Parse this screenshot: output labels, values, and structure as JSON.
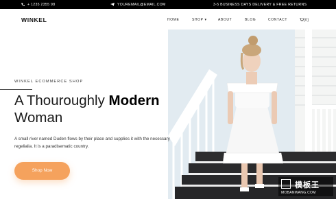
{
  "topbar": {
    "phone": "+ 1235 2355 98",
    "email": "YOUREMAIL@EMAIL.COM",
    "promo": "3-5 BUSINESS DAYS DELIVERY & FREE RETURNS"
  },
  "brand": {
    "logo": "WINKEL"
  },
  "nav": {
    "home": "HOME",
    "shop": "SHOP ▾",
    "about": "ABOUT",
    "blog": "BLOG",
    "contact": "CONTACT",
    "cart": "[0]"
  },
  "hero": {
    "eyebrow": "WINKEL ECOMMERCE SHOP",
    "headline_regular": "A Thouroughly",
    "headline_bold": "Modern",
    "headline_line2": "Woman",
    "description": "A small river named Duden flows by their place and supplies it with the necessary regelialia. It is a paradisematic country.",
    "cta": "Shop Now"
  },
  "watermark": {
    "cn": "模板王",
    "en": "MOBANWANG.COM"
  },
  "colors": {
    "accent": "#f5a25d",
    "topbar": "#000000"
  },
  "icons": {
    "phone": "phone-icon",
    "email": "paper-plane-icon",
    "cart": "cart-icon"
  }
}
